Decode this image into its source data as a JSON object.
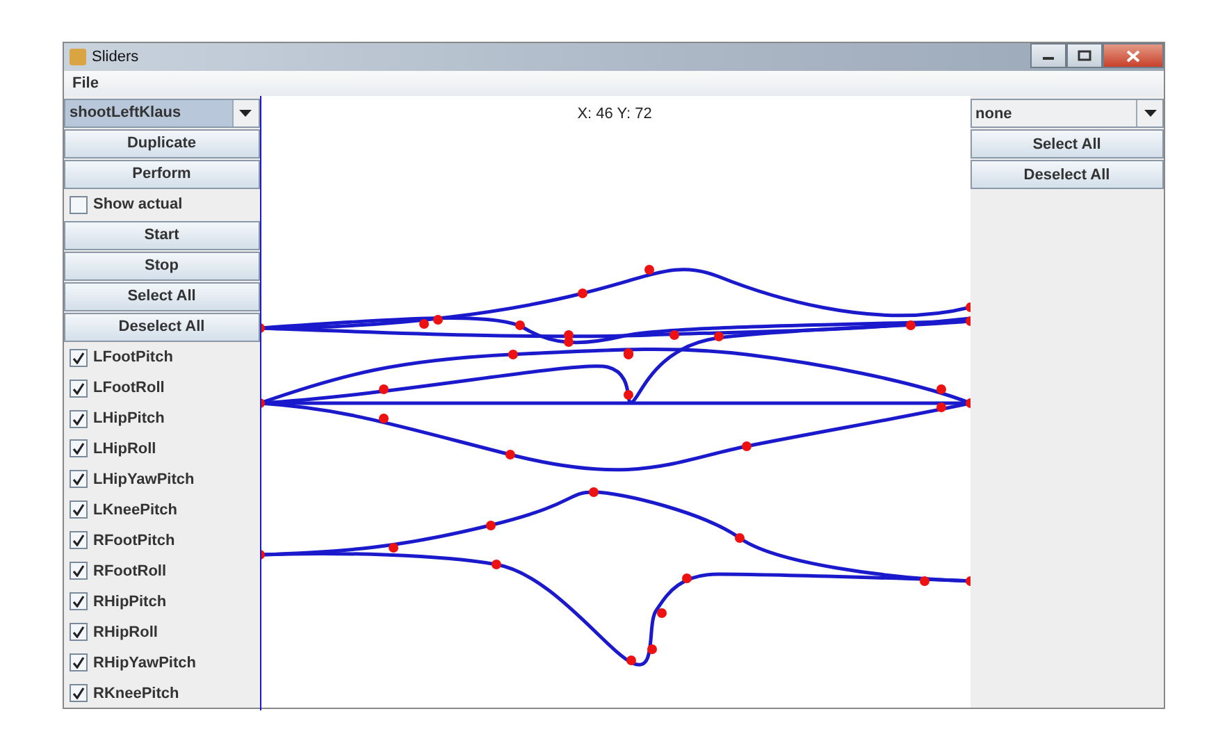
{
  "window": {
    "title": "Sliders"
  },
  "menu": [
    "File"
  ],
  "left_panel": {
    "dropdown": {
      "value": "shootLeftKlaus"
    },
    "items": [
      {
        "kind": "button",
        "label": "Duplicate"
      },
      {
        "kind": "button",
        "label": "Perform"
      },
      {
        "kind": "checkbox",
        "label": "Show actual",
        "checked": false
      },
      {
        "kind": "button",
        "label": "Start"
      },
      {
        "kind": "button",
        "label": "Stop"
      },
      {
        "kind": "button",
        "label": "Select All"
      },
      {
        "kind": "button",
        "label": "Deselect All"
      },
      {
        "kind": "checkbox",
        "label": "LFootPitch",
        "checked": true
      },
      {
        "kind": "checkbox",
        "label": "LFootRoll",
        "checked": true
      },
      {
        "kind": "checkbox",
        "label": "LHipPitch",
        "checked": true
      },
      {
        "kind": "checkbox",
        "label": "LHipRoll",
        "checked": true
      },
      {
        "kind": "checkbox",
        "label": "LHipYawPitch",
        "checked": true
      },
      {
        "kind": "checkbox",
        "label": "LKneePitch",
        "checked": true
      },
      {
        "kind": "checkbox",
        "label": "RFootPitch",
        "checked": true
      },
      {
        "kind": "checkbox",
        "label": "RFootRoll",
        "checked": true
      },
      {
        "kind": "checkbox",
        "label": "RHipPitch",
        "checked": true
      },
      {
        "kind": "checkbox",
        "label": "RHipRoll",
        "checked": true
      },
      {
        "kind": "checkbox",
        "label": "RHipYawPitch",
        "checked": true
      },
      {
        "kind": "checkbox",
        "label": "RKneePitch",
        "checked": true
      }
    ]
  },
  "canvas": {
    "coordinates": "X: 46 Y: 72"
  },
  "right_panel": {
    "dropdown": {
      "value": "none"
    },
    "buttons": [
      "Select All",
      "Deselect All"
    ]
  }
}
